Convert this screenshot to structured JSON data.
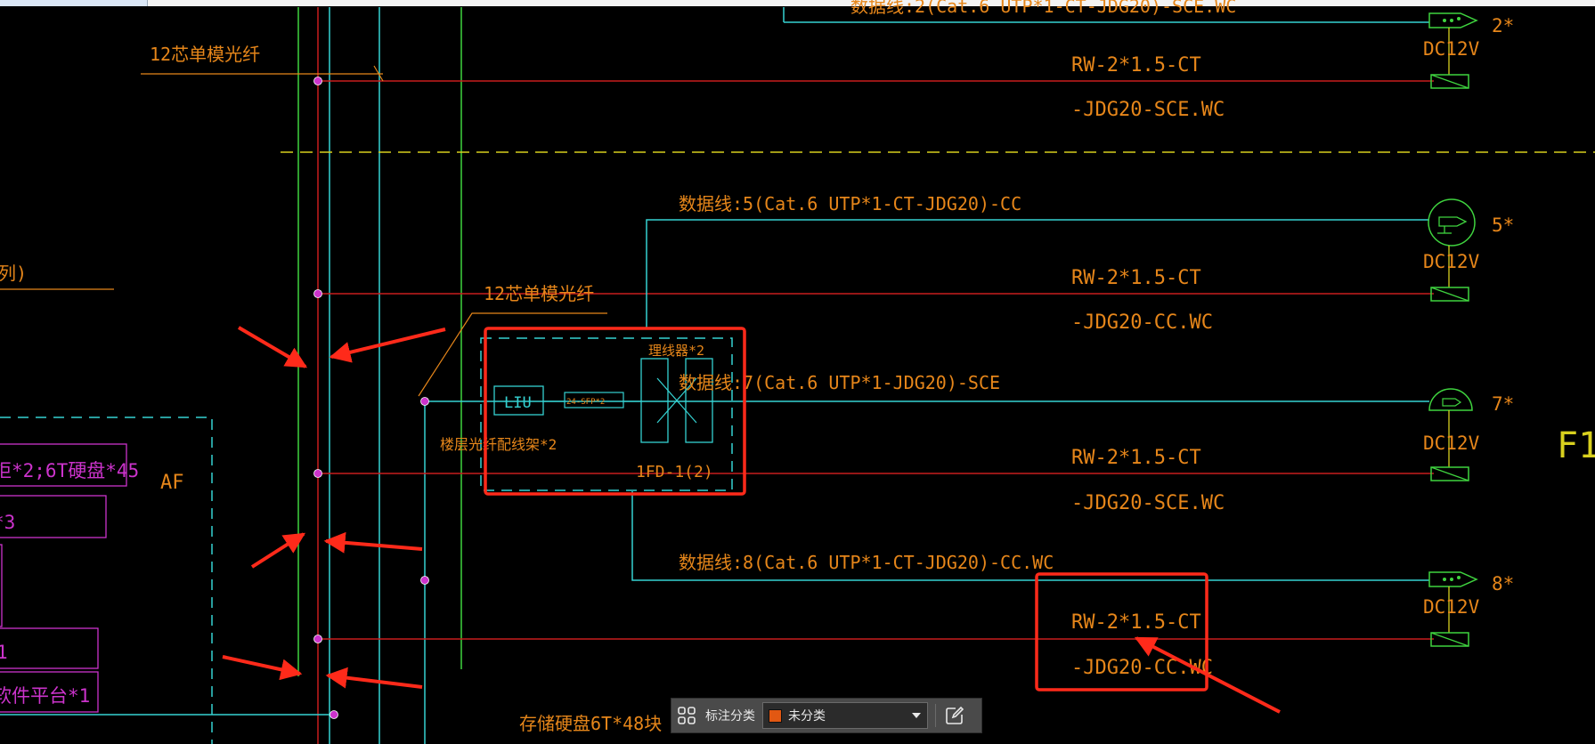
{
  "colors": {
    "background": "#000000",
    "cyan": "#35d2d2",
    "green": "#3fd43f",
    "red": "#c81e1e",
    "orange": "#e6861a",
    "magenta": "#cc33cc",
    "yellow": "#d8d01e",
    "highlight": "#ff2a1a"
  },
  "labels": {
    "fiber_top": "12芯单模光纤",
    "fiber_mid": "12芯单模光纤",
    "left_cut": "列)",
    "af": "AF",
    "magenta_row1": "柜*2;6T硬盘*45",
    "magenta_row2": "*3",
    "magenta_row3": "1",
    "magenta_row4": "软件平台*1",
    "cut_top": "数据线:2(Cat.6 UTP*1-CT-JDG20)-SCE.WC",
    "data_line_5": "数据线:5(Cat.6 UTP*1-CT-JDG20)-CC",
    "data_line_7": "数据线:7(Cat.6 UTP*1-JDG20)-SCE",
    "data_line_8": "数据线:8(Cat.6 UTP*1-CT-JDG20)-CC.WC",
    "rw_top_1": "RW-2*1.5-CT",
    "rw_top_2": "-JDG20-SCE.WC",
    "rw_5_1": "RW-2*1.5-CT",
    "rw_5_2": "-JDG20-CC.WC",
    "rw_7_1": "RW-2*1.5-CT",
    "rw_7_2": "-JDG20-SCE.WC",
    "rw_8_1": "RW-2*1.5-CT",
    "rw_8_2": "-JDG20-CC.WC",
    "dc_2": "DC12V",
    "dc_5": "DC12V",
    "dc_7": "DC12V",
    "dc_8": "DC12V",
    "cam_2": "2*",
    "cam_5": "5*",
    "cam_7": "7*",
    "cam_8": "8*",
    "floor": "F1",
    "liu": "LIU",
    "patch": "24-SFP*2",
    "manager": "理线器*2",
    "fiber_frame": "楼层光纤配线架*2",
    "fd_label": "1FD-1(2)",
    "storage": "存储硬盘6T*48块"
  },
  "toolbar": {
    "grid_icon": "grid-icon",
    "label": "标注分类",
    "select_value": "未分类",
    "swatch_color": "#e25812",
    "edit_icon": "edit-icon"
  }
}
